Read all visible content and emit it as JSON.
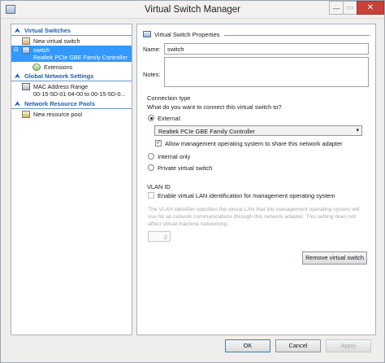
{
  "window": {
    "title": "Virtual Switch Manager",
    "minimize_icon": "minimize-icon",
    "maximize_icon": "maximize-icon",
    "close_icon": "close-icon",
    "min_glyph": "—",
    "max_glyph": "▭",
    "close_glyph": "✕"
  },
  "tree": {
    "collapse_glyph": "⮝",
    "virtual_switches": {
      "label": "Virtual Switches",
      "new_switch": "New virtual switch",
      "switch_name": "switch",
      "switch_adapter": "Realtek PCIe GBE Family Controller",
      "extensions": "Extensions",
      "expander": "⊟"
    },
    "global_network": {
      "label": "Global Network Settings",
      "mac_range": "MAC Address Range",
      "mac_value": "00-15-5D-01-04-00 to 00-15-5D-0..."
    },
    "resource_pools": {
      "label": "Network Resource Pools",
      "new_pool": "New resource pool"
    }
  },
  "properties": {
    "header": "Virtual Switch Properties",
    "name_label": "Name:",
    "name_value": "switch",
    "notes_label": "Notes:",
    "notes_value": "",
    "connection_type": {
      "heading": "Connection type",
      "question": "What do you want to connect this virtual switch to?",
      "external_label": "External:",
      "adapter_selected": "Realtek PCIe GBE Family Controller",
      "allow_mgmt_label": "Allow management operating system to share this network adapter",
      "allow_mgmt_checked": true,
      "internal_label": "Internal only",
      "private_label": "Private virtual switch",
      "selected": "external",
      "dropdown_arrow": "▾",
      "check_glyph": "✓"
    },
    "vlan": {
      "heading": "VLAN ID",
      "enable_label": "Enable virtual LAN identification for management operating system",
      "enable_checked": false,
      "description": "The VLAN identifier specifies the virtual LAN that the management operating system will use for all network communications through this network adapter. This setting does not affect virtual machine networking.",
      "vlan_value": "2"
    },
    "remove_button": "Remove virtual switch"
  },
  "footer": {
    "ok": "OK",
    "cancel": "Cancel",
    "apply": "Apply"
  }
}
